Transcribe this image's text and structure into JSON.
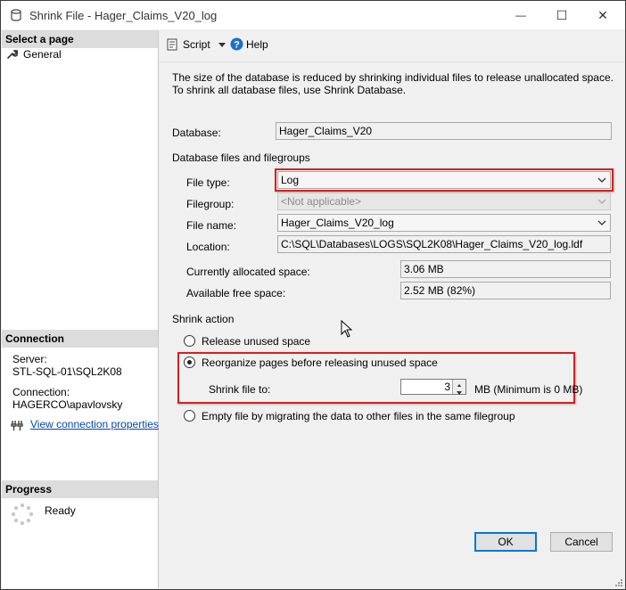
{
  "window": {
    "title": "Shrink File - Hager_Claims_V20_log",
    "minimize_label": "—",
    "maximize_label": "☐",
    "close_label": "✕"
  },
  "sidebar": {
    "select_page_header": "Select a page",
    "items": [
      {
        "label": "General",
        "icon": "wrench-icon"
      }
    ],
    "connection_header": "Connection",
    "server_label": "Server:",
    "server_value": "STL-SQL-01\\SQL2K08",
    "connection_label": "Connection:",
    "connection_value": "HAGERCO\\apavlovsky",
    "view_connection_link": "View connection properties",
    "progress_header": "Progress",
    "progress_status": "Ready"
  },
  "toolbar": {
    "script_label": "Script",
    "help_label": "Help"
  },
  "main": {
    "description": "The size of the database is reduced by shrinking individual files to release unallocated space. To shrink all database files, use Shrink Database.",
    "database_label": "Database:",
    "database_value": "Hager_Claims_V20",
    "files_group_label": "Database files and filegroups",
    "file_type_label": "File type:",
    "file_type_value": "Log",
    "filegroup_label": "Filegroup:",
    "filegroup_value": "<Not applicable>",
    "file_name_label": "File name:",
    "file_name_value": "Hager_Claims_V20_log",
    "location_label": "Location:",
    "location_value": "C:\\SQL\\Databases\\LOGS\\SQL2K08\\Hager_Claims_V20_log.ldf",
    "allocated_label": "Currently allocated space:",
    "allocated_value": "3.06 MB",
    "free_label": "Available free space:",
    "free_value": "2.52 MB (82%)",
    "shrink_action_label": "Shrink action",
    "option_release": "Release unused space",
    "option_reorganize": "Reorganize pages before releasing unused space",
    "shrink_file_to_label": "Shrink file to:",
    "shrink_file_to_value": "3",
    "shrink_unit_note": "MB (Minimum is 0 MB)",
    "option_empty": "Empty file by migrating the data to other files in the same filegroup",
    "selected_option": "reorganize"
  },
  "footer": {
    "ok_label": "OK",
    "cancel_label": "Cancel"
  },
  "colors": {
    "highlight_border": "#d32020",
    "link": "#0645ad",
    "help_icon": "#1e6fc5"
  }
}
